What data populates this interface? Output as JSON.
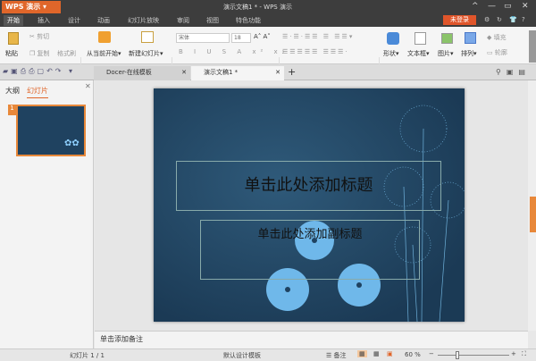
{
  "app": {
    "logo": "WPS 演示",
    "title": "演示文稿1 * - WPS 演示",
    "login": "未登录"
  },
  "menu": [
    "开始",
    "插入",
    "设计",
    "动画",
    "幻灯片放映",
    "审阅",
    "视图",
    "特色功能"
  ],
  "ribbon": {
    "paste": "粘贴",
    "cut": "剪切",
    "copy": "复制",
    "format_painter": "格式刷",
    "from_current": "从当前开始",
    "new_slide": "新建幻灯片",
    "font": "宋体",
    "font_size": "18",
    "shape": "形状",
    "textbox": "文本框",
    "picture": "图片",
    "arrange": "排列",
    "fill": "填充",
    "outline": "轮廓"
  },
  "tabs": [
    {
      "label": "Docer-在线模板"
    },
    {
      "label": "演示文稿1 *"
    }
  ],
  "panel": {
    "tab_outline": "大纲",
    "tab_slides": "幻灯片",
    "slide_num": "1"
  },
  "slide": {
    "title": "单击此处添加标题",
    "subtitle": "单击此处添加副标题"
  },
  "notes": "单击添加备注",
  "status": {
    "slide_count": "幻灯片 1 / 1",
    "template": "默认设计模板",
    "notes": "备注",
    "zoom": "60 %"
  },
  "zoom_percent": 60,
  "colors": {
    "accent": "#e0662a",
    "titlebar": "#3d3d3d",
    "slide_bg": "#1f4260"
  }
}
